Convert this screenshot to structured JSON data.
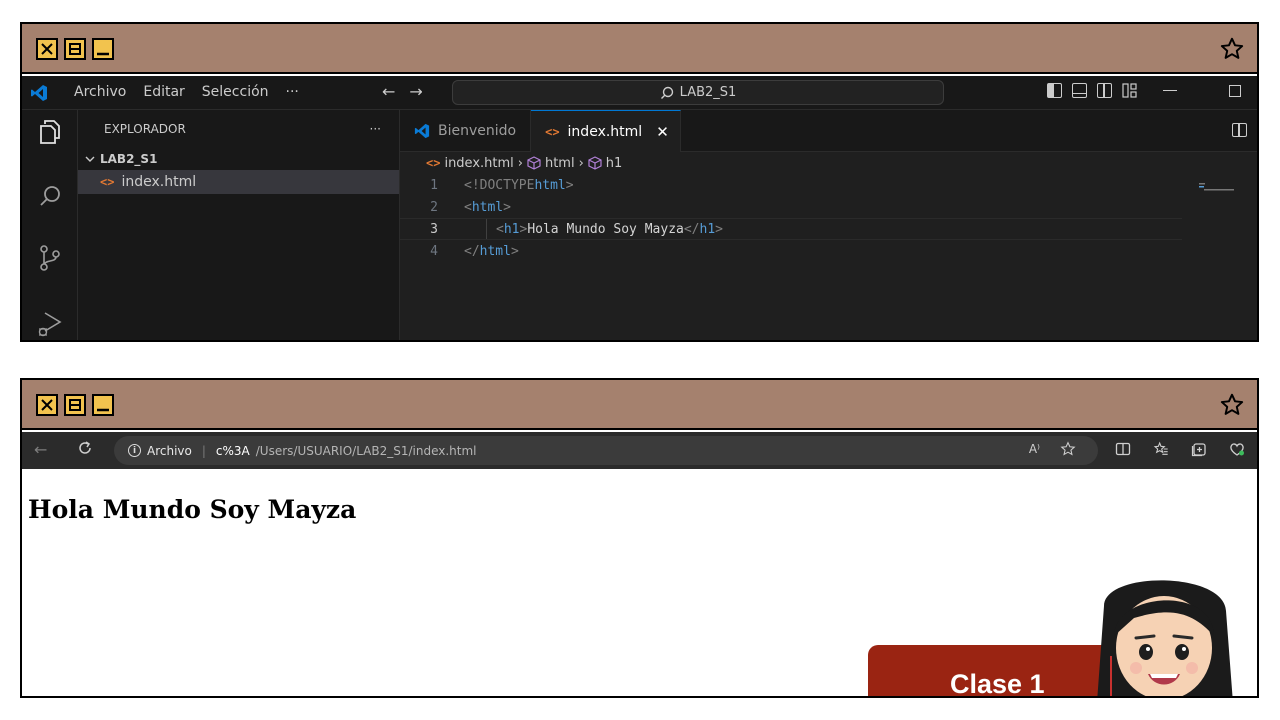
{
  "vscode": {
    "menu": [
      "Archivo",
      "Editar",
      "Selección",
      "···"
    ],
    "search": "LAB2_S1",
    "explorer_title": "EXPLORADOR",
    "explorer_more": "···",
    "folder": "LAB2_S1",
    "file": "index.html",
    "tabs": [
      {
        "label": "Bienvenido"
      },
      {
        "label": "index.html",
        "close": "✕"
      }
    ],
    "breadcrumb": [
      "index.html",
      "html",
      "h1"
    ],
    "code_lines": [
      {
        "num": "1",
        "open": "<!DOCTYPE ",
        "name": "html",
        "close": ">",
        "text": "",
        "name2": "",
        "indent": false
      },
      {
        "num": "2",
        "open": "<",
        "name": "html",
        "close": ">",
        "text": "",
        "name2": "",
        "indent": false
      },
      {
        "num": "3",
        "open": "<",
        "name": "h1",
        "close": ">",
        "text": "Hola Mundo Soy Mayza",
        "name2": "h1",
        "indent": true
      },
      {
        "num": "4",
        "open": "</",
        "name": "html",
        "close": ">",
        "text": "",
        "name2": "",
        "indent": false
      }
    ]
  },
  "browser": {
    "url_label": "Archivo",
    "url_host": "c%3A",
    "url_path": "/Users/USUARIO/LAB2_S1/index.html",
    "read_aloud": "A⁾",
    "page_heading": "Hola Mundo Soy Mayza"
  },
  "badge": {
    "label": "Clase 1"
  },
  "colors": {
    "retro_bar": "#a5816e",
    "retro_button": "#f2c34e",
    "vscode_bg": "#1f1f1f",
    "accent": "#0078d4",
    "badge": "#9a2412"
  }
}
